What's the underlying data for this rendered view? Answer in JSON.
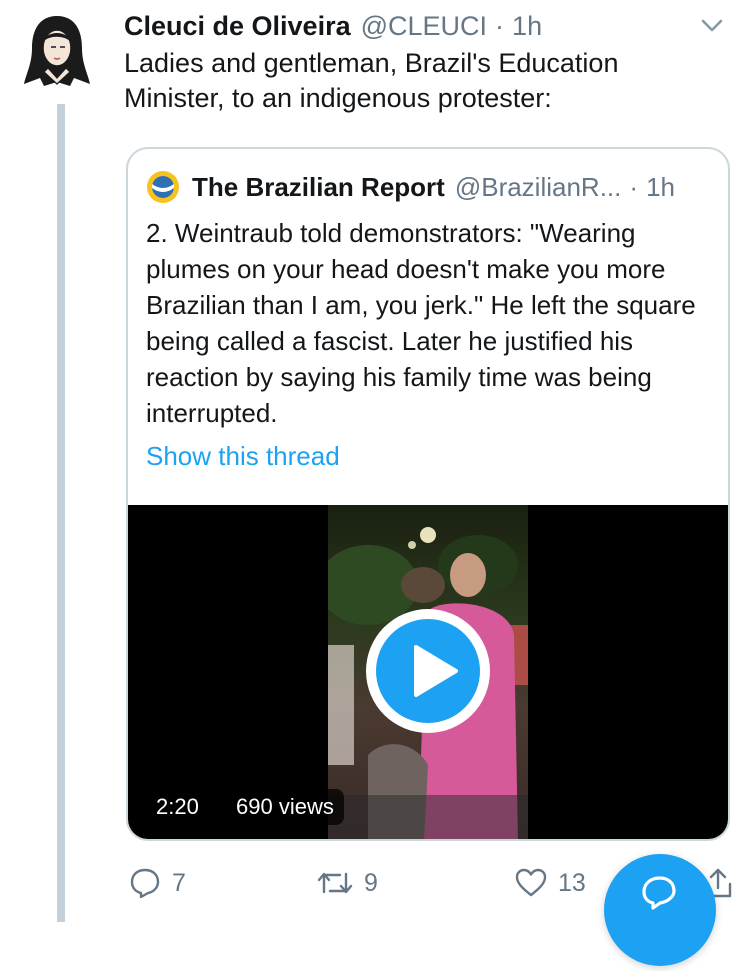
{
  "tweet": {
    "author_name": "Cleuci de Oliveira",
    "handle": "@CLEUCI",
    "separator": "·",
    "time": "1h",
    "text": "Ladies and gentleman, Brazil's Education Minister, to an indigenous protester:",
    "avatar_icon": "illustrated-portrait-avatar",
    "menu_icon": "chevron-down-icon"
  },
  "quoted_tweet": {
    "author_name": "The Brazilian Report",
    "handle": "@BrazilianR...",
    "separator": "·",
    "time": "1h",
    "logo_icon": "brazilian-report-logo",
    "text": "2. Weintraub told demonstrators: \"Wearing plumes on your head doesn't make you more Brazilian than I am, you jerk.\" He left the square being called a fascist. Later he justified his reaction by saying his family time was being interrupted.",
    "show_thread": "Show this thread",
    "video": {
      "duration": "2:20",
      "views": "690 views",
      "play_icon": "play-icon"
    }
  },
  "actions": {
    "reply_count": "7",
    "retweet_count": "9",
    "like_count": "13",
    "reply_icon": "reply-icon",
    "retweet_icon": "retweet-icon",
    "like_icon": "heart-icon",
    "share_icon": "share-icon"
  },
  "compose_button": {
    "icon": "compose-icon"
  },
  "colors": {
    "accent": "#1da1f2",
    "text_primary": "#14171a",
    "text_secondary": "#657786",
    "border": "#ccd6dd",
    "thread_line": "#c4d0db"
  }
}
